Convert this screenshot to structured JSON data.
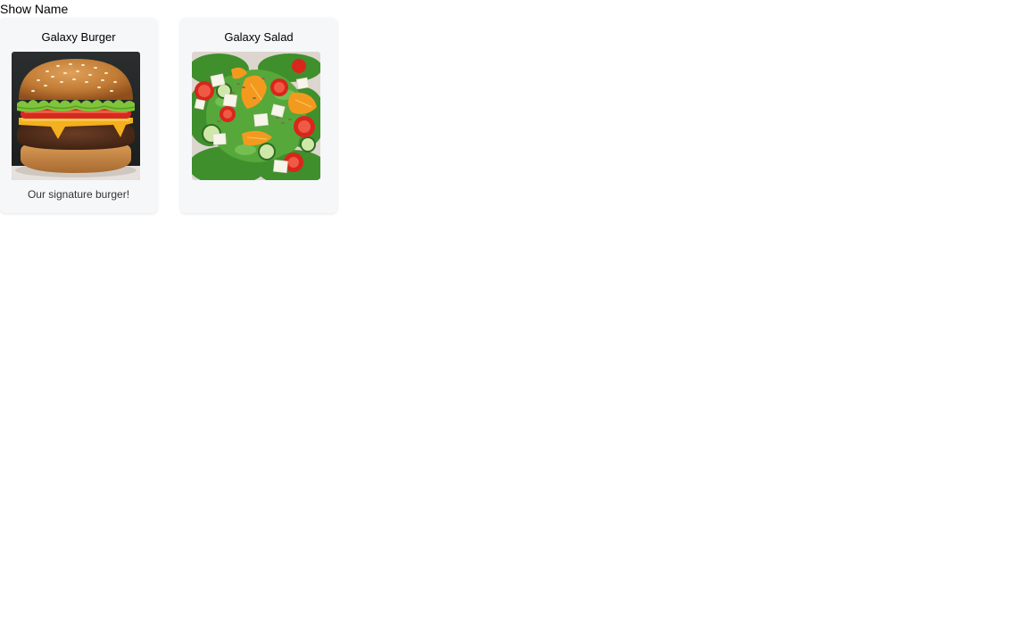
{
  "toggle": {
    "label": "Show Name"
  },
  "cards": [
    {
      "title": "Galaxy Burger",
      "description": "Our signature burger!",
      "image": "burger-photo"
    },
    {
      "title": "Galaxy Salad",
      "description": "",
      "image": "salad-photo"
    }
  ]
}
